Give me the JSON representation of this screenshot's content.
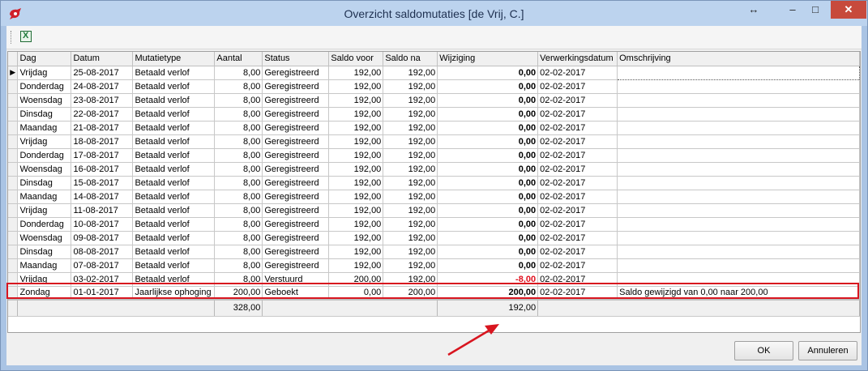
{
  "window": {
    "title": "Overzicht saldomutaties [de Vrij, C.]",
    "move_glyph": "↔",
    "min_glyph": "–",
    "max_glyph": "□",
    "close_glyph": "✕"
  },
  "toolbar": {
    "export_icon": "excel-icon",
    "export_glyph": "X"
  },
  "grid": {
    "columns": [
      "Dag",
      "Datum",
      "Mutatietype",
      "Aantal",
      "Status",
      "Saldo voor",
      "Saldo na",
      "Wijziging",
      "Verwerkingsdatum",
      "Omschrijving"
    ],
    "rows": [
      {
        "dag": "Vrijdag",
        "datum": "25-08-2017",
        "type": "Betaald verlof",
        "aantal": "8,00",
        "status": "Geregistreerd",
        "voor": "192,00",
        "na": "192,00",
        "wijziging": "0,00",
        "verwerking": "02-02-2017",
        "omschrijving": "",
        "indicator": "▶"
      },
      {
        "dag": "Donderdag",
        "datum": "24-08-2017",
        "type": "Betaald verlof",
        "aantal": "8,00",
        "status": "Geregistreerd",
        "voor": "192,00",
        "na": "192,00",
        "wijziging": "0,00",
        "verwerking": "02-02-2017",
        "omschrijving": ""
      },
      {
        "dag": "Woensdag",
        "datum": "23-08-2017",
        "type": "Betaald verlof",
        "aantal": "8,00",
        "status": "Geregistreerd",
        "voor": "192,00",
        "na": "192,00",
        "wijziging": "0,00",
        "verwerking": "02-02-2017",
        "omschrijving": ""
      },
      {
        "dag": "Dinsdag",
        "datum": "22-08-2017",
        "type": "Betaald verlof",
        "aantal": "8,00",
        "status": "Geregistreerd",
        "voor": "192,00",
        "na": "192,00",
        "wijziging": "0,00",
        "verwerking": "02-02-2017",
        "omschrijving": ""
      },
      {
        "dag": "Maandag",
        "datum": "21-08-2017",
        "type": "Betaald verlof",
        "aantal": "8,00",
        "status": "Geregistreerd",
        "voor": "192,00",
        "na": "192,00",
        "wijziging": "0,00",
        "verwerking": "02-02-2017",
        "omschrijving": ""
      },
      {
        "dag": "Vrijdag",
        "datum": "18-08-2017",
        "type": "Betaald verlof",
        "aantal": "8,00",
        "status": "Geregistreerd",
        "voor": "192,00",
        "na": "192,00",
        "wijziging": "0,00",
        "verwerking": "02-02-2017",
        "omschrijving": ""
      },
      {
        "dag": "Donderdag",
        "datum": "17-08-2017",
        "type": "Betaald verlof",
        "aantal": "8,00",
        "status": "Geregistreerd",
        "voor": "192,00",
        "na": "192,00",
        "wijziging": "0,00",
        "verwerking": "02-02-2017",
        "omschrijving": ""
      },
      {
        "dag": "Woensdag",
        "datum": "16-08-2017",
        "type": "Betaald verlof",
        "aantal": "8,00",
        "status": "Geregistreerd",
        "voor": "192,00",
        "na": "192,00",
        "wijziging": "0,00",
        "verwerking": "02-02-2017",
        "omschrijving": ""
      },
      {
        "dag": "Dinsdag",
        "datum": "15-08-2017",
        "type": "Betaald verlof",
        "aantal": "8,00",
        "status": "Geregistreerd",
        "voor": "192,00",
        "na": "192,00",
        "wijziging": "0,00",
        "verwerking": "02-02-2017",
        "omschrijving": ""
      },
      {
        "dag": "Maandag",
        "datum": "14-08-2017",
        "type": "Betaald verlof",
        "aantal": "8,00",
        "status": "Geregistreerd",
        "voor": "192,00",
        "na": "192,00",
        "wijziging": "0,00",
        "verwerking": "02-02-2017",
        "omschrijving": ""
      },
      {
        "dag": "Vrijdag",
        "datum": "11-08-2017",
        "type": "Betaald verlof",
        "aantal": "8,00",
        "status": "Geregistreerd",
        "voor": "192,00",
        "na": "192,00",
        "wijziging": "0,00",
        "verwerking": "02-02-2017",
        "omschrijving": ""
      },
      {
        "dag": "Donderdag",
        "datum": "10-08-2017",
        "type": "Betaald verlof",
        "aantal": "8,00",
        "status": "Geregistreerd",
        "voor": "192,00",
        "na": "192,00",
        "wijziging": "0,00",
        "verwerking": "02-02-2017",
        "omschrijving": ""
      },
      {
        "dag": "Woensdag",
        "datum": "09-08-2017",
        "type": "Betaald verlof",
        "aantal": "8,00",
        "status": "Geregistreerd",
        "voor": "192,00",
        "na": "192,00",
        "wijziging": "0,00",
        "verwerking": "02-02-2017",
        "omschrijving": ""
      },
      {
        "dag": "Dinsdag",
        "datum": "08-08-2017",
        "type": "Betaald verlof",
        "aantal": "8,00",
        "status": "Geregistreerd",
        "voor": "192,00",
        "na": "192,00",
        "wijziging": "0,00",
        "verwerking": "02-02-2017",
        "omschrijving": ""
      },
      {
        "dag": "Maandag",
        "datum": "07-08-2017",
        "type": "Betaald verlof",
        "aantal": "8,00",
        "status": "Geregistreerd",
        "voor": "192,00",
        "na": "192,00",
        "wijziging": "0,00",
        "verwerking": "02-02-2017",
        "omschrijving": ""
      },
      {
        "dag": "Vrijdag",
        "datum": "03-02-2017",
        "type": "Betaald verlof",
        "aantal": "8,00",
        "status": "Verstuurd",
        "voor": "200,00",
        "na": "192,00",
        "wijziging": "-8,00",
        "verwerking": "02-02-2017",
        "omschrijving": "",
        "negative": true,
        "highlighted": true
      },
      {
        "dag": "Zondag",
        "datum": "01-01-2017",
        "type": "Jaarlijkse ophoging",
        "aantal": "200,00",
        "status": "Geboekt",
        "voor": "0,00",
        "na": "200,00",
        "wijziging": "200,00",
        "verwerking": "02-02-2017",
        "omschrijving": "Saldo gewijzigd van 0,00 naar  200,00"
      }
    ],
    "totals": {
      "aantal": "328,00",
      "wijziging": "192,00"
    }
  },
  "buttons": {
    "ok": "OK",
    "cancel": "Annuleren"
  },
  "colors": {
    "highlight": "#d8151f",
    "negative": "#e0101e",
    "app_icon": "#d0202a"
  }
}
